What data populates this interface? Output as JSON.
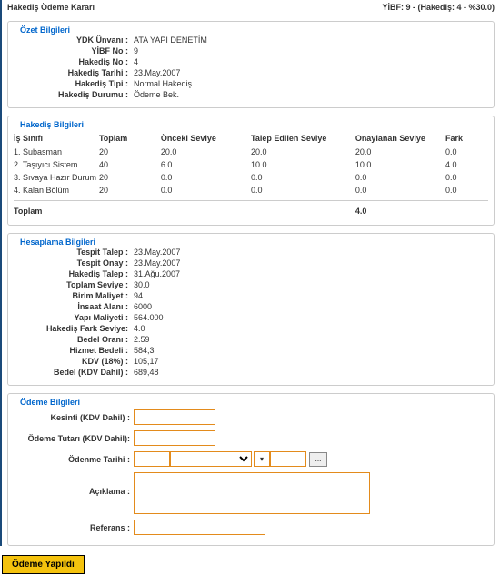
{
  "header": {
    "title": "Hakediş Ödeme Kararı",
    "right": "YİBF: 9 - (Hakediş: 4 - %30.0)"
  },
  "summary": {
    "legend": "Özet Bilgileri",
    "ydk_unvani_label": "YDK Ünvanı :",
    "ydk_unvani": "ATA YAPI DENETİM",
    "yibf_no_label": "YİBF No :",
    "yibf_no": "9",
    "hakedis_no_label": "Hakediş No :",
    "hakedis_no": "4",
    "hakedis_tarihi_label": "Hakediş Tarihi :",
    "hakedis_tarihi": "23.May.2007",
    "hakedis_tipi_label": "Hakediş Tipi :",
    "hakedis_tipi": "Normal Hakediş",
    "hakedis_durumu_label": "Hakediş Durumu :",
    "hakedis_durumu": "Ödeme Bek."
  },
  "hakedis": {
    "legend": "Hakediş Bilgileri",
    "headers": {
      "c1": "İş Sınıfı",
      "c2": "Toplam",
      "c3": "Önceki Seviye",
      "c4": "Talep Edilen Seviye",
      "c5": "Onaylanan Seviye",
      "c6": "Fark"
    },
    "rows": [
      {
        "c1": "1. Subasman",
        "c2": "20",
        "c3": "20.0",
        "c4": "20.0",
        "c5": "20.0",
        "c6": "0.0"
      },
      {
        "c1": "2. Taşıyıcı Sistem",
        "c2": "40",
        "c3": "6.0",
        "c4": "10.0",
        "c5": "10.0",
        "c6": "4.0"
      },
      {
        "c1": "3. Sıvaya Hazır Durum",
        "c2": "20",
        "c3": "0.0",
        "c4": "0.0",
        "c5": "0.0",
        "c6": "0.0"
      },
      {
        "c1": "4. Kalan Bölüm",
        "c2": "20",
        "c3": "0.0",
        "c4": "0.0",
        "c5": "0.0",
        "c6": "0.0"
      }
    ],
    "total_label": "Toplam",
    "total_value": "4.0"
  },
  "calc": {
    "legend": "Hesaplama Bilgileri",
    "items": [
      {
        "label": "Tespit Talep :",
        "value": "23.May.2007"
      },
      {
        "label": "Tespit Onay :",
        "value": "23.May.2007"
      },
      {
        "label": "Hakediş Talep :",
        "value": "31.Ağu.2007"
      },
      {
        "label": "Toplam Seviye :",
        "value": "30.0"
      },
      {
        "label": "Birim Maliyet :",
        "value": "94"
      },
      {
        "label": "İnsaat Alanı :",
        "value": "6000"
      },
      {
        "label": "Yapı Maliyeti :",
        "value": "564.000"
      },
      {
        "label": "Hakediş Fark Seviye:",
        "value": "4.0"
      },
      {
        "label": "Bedel Oranı :",
        "value": "2.59"
      },
      {
        "label": "Hizmet Bedeli :",
        "value": "584,3"
      },
      {
        "label": "KDV (18%) :",
        "value": "105,17"
      },
      {
        "label": "Bedel (KDV Dahil) :",
        "value": "689,48"
      }
    ]
  },
  "payment": {
    "legend": "Ödeme Bilgileri",
    "kesinti_label": "Kesinti (KDV Dahil) :",
    "tutar_label": "Ödeme Tutarı (KDV Dahil):",
    "tarih_label": "Ödenme Tarihi :",
    "aciklama_label": "Açıklama :",
    "referans_label": "Referans :",
    "dots": "..."
  },
  "action": {
    "label": "Ödeme Yapıldı"
  }
}
